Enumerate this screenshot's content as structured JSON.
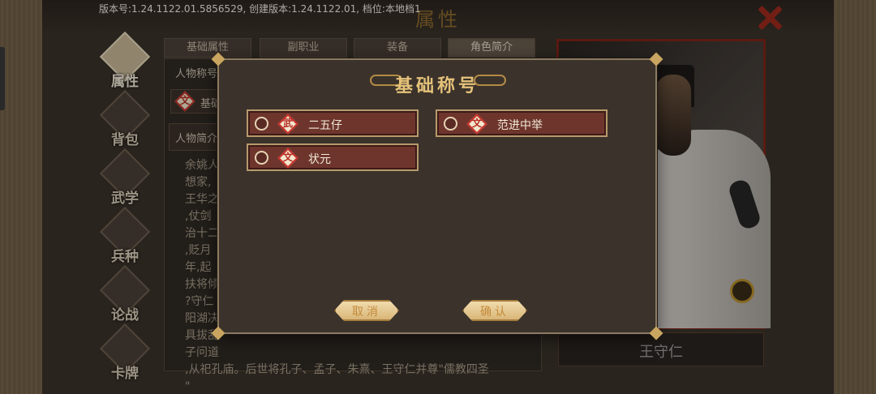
{
  "version_text": "版本号:1.24.1122.01.5856529, 创建版本:1.24.1122.01, 档位:本地档1",
  "page_title": "属性",
  "nav": {
    "items": [
      {
        "label": "属性",
        "icon": "person-icon",
        "active": true
      },
      {
        "label": "背包",
        "icon": "bag-icon"
      },
      {
        "label": "武学",
        "icon": "book-icon"
      },
      {
        "label": "兵种",
        "icon": "horse-icon"
      },
      {
        "label": "论战",
        "icon": "chat-icon"
      },
      {
        "label": "卡牌",
        "icon": "card-icon"
      }
    ]
  },
  "tabs": [
    {
      "label": "基础属性"
    },
    {
      "label": "副职业"
    },
    {
      "label": "装备"
    },
    {
      "label": "角色简介",
      "active": true
    }
  ],
  "char_panel": {
    "title_label": "人物称号",
    "title_badge": "文",
    "title_value": "基础",
    "intro_label": "人物简介",
    "bio_lines": [
      "余姚人",
      "想家,",
      "王华之",
      ",仗剑",
      "治十二",
      ",贬月",
      "年,起",
      "扶将倾",
      "?守仁",
      "阳湖决",
      "具拔乱",
      "子问道",
      ",从祀孔庙。后世将孔子、孟子、朱熹、王守仁并尊\"儒教四圣",
      "\""
    ]
  },
  "portrait": {
    "name": "王守仁"
  },
  "modal": {
    "title": "基础称号",
    "options": [
      {
        "badge": "武",
        "label": "二五仔",
        "badge_color": "#b52a22"
      },
      {
        "badge": "文",
        "label": "范进中举",
        "badge_color": "#b52a22"
      },
      {
        "badge": "文",
        "label": "状元",
        "badge_color": "#b52a22"
      }
    ],
    "cancel_label": "取消",
    "confirm_label": "确认"
  },
  "colors": {
    "accent_gold": "#e4c27a",
    "option_bg": "#6e352d",
    "close_red": "#9e2a1e"
  }
}
